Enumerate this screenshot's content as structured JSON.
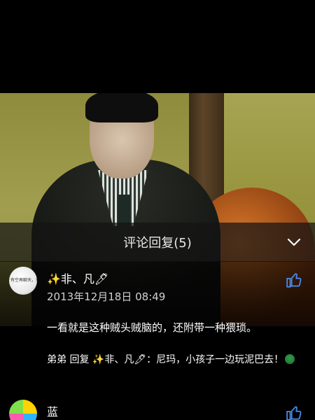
{
  "header": {
    "title": "评论回复(5)",
    "collapse_icon": "chevron-down-icon"
  },
  "comments": [
    {
      "avatar_text": "有空再聊天，有你叫",
      "name": "✨非、凡🖊",
      "time": "2013年12月18日 08:49",
      "text": "一看就是这种贼头贼脑的，还附带一种猥琐。",
      "reply": {
        "from": "弟弟",
        "verb": "回复",
        "to": "✨非、凡🖊",
        "content": "：尼玛，小孩子一边玩泥巴去！"
      },
      "like_icon": "thumbs-up-icon"
    },
    {
      "name": "蓝",
      "like_icon": "thumbs-up-icon"
    }
  ],
  "colors": {
    "background": "#000000",
    "header_bg": "#141414",
    "text": "#ffffff",
    "muted": "#d0d0d0"
  }
}
